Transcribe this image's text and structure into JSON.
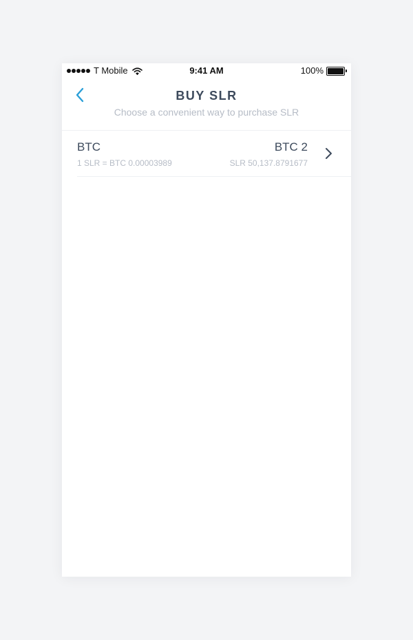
{
  "status_bar": {
    "carrier": "T Mobile",
    "time": "9:41 AM",
    "battery": "100%",
    "battery_level": 1.0,
    "signal_bars": 5
  },
  "header": {
    "title": "BUY SLR",
    "subtitle": "Choose a convenient way to purchase SLR",
    "back_icon": "chevron-left-icon"
  },
  "purchase_options": [
    {
      "name": "BTC",
      "rate": "1 SLR = BTC 0.00003989",
      "amount": "BTC 2",
      "equivalent": "SLR 50,137.8791677",
      "action_icon": "chevron-right-icon"
    }
  ],
  "colors": {
    "accent": "#2a9fd8",
    "title_text": "#3d4a5c",
    "secondary_text": "#b6bcc6",
    "page_background": "#f3f4f6",
    "screen_background": "#ffffff"
  }
}
